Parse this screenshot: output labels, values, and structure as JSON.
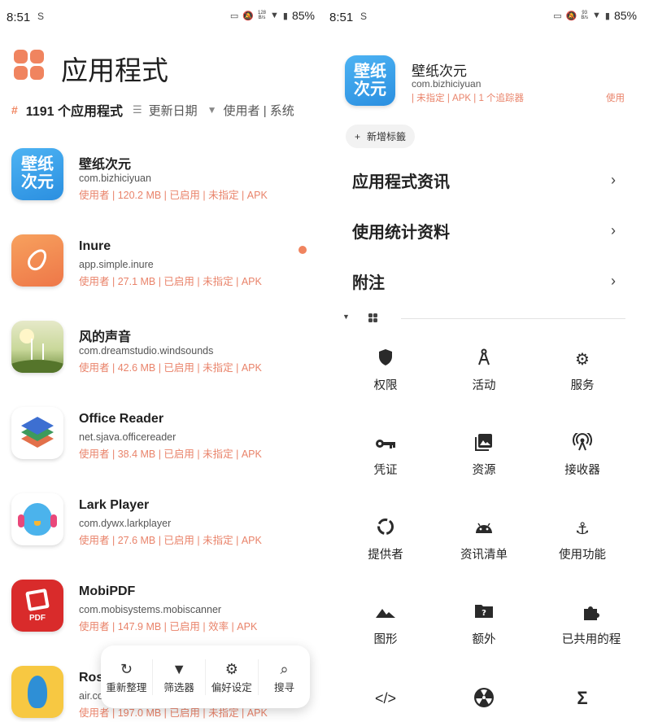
{
  "left_panel": {
    "status": {
      "time": "8:51",
      "sim_icon": "S",
      "net_speed_top": "128",
      "net_speed_unit": "B/s",
      "battery": "85%"
    },
    "title": "应用程式",
    "summary": {
      "count_label": "1191 个应用程式",
      "sort_label": "更新日期",
      "filter_label": "使用者 | 系统"
    },
    "apps": [
      {
        "name": "壁纸次元",
        "package": "com.bizhiciyuan",
        "meta": "使用者 | 120.2 MB | 已启用 | 未指定 | APK",
        "icon_text": "壁纸\n次元",
        "icon": "bizhiciyuan-icon"
      },
      {
        "name": "Inure",
        "package": "app.simple.inure",
        "meta": "使用者 | 27.1 MB | 已启用 | 未指定 | APK",
        "icon": "inure-icon",
        "badge": true
      },
      {
        "name": "风的声音",
        "package": "com.dreamstudio.windsounds",
        "meta": "使用者 | 42.6 MB | 已启用 | 未指定 | APK",
        "icon": "windmill-icon"
      },
      {
        "name": "Office Reader",
        "package": "net.sjava.officereader",
        "meta": "使用者 | 38.4 MB | 已启用 | 未指定 | APK",
        "icon": "office-reader-icon"
      },
      {
        "name": "Lark Player",
        "package": "com.dywx.larkplayer",
        "meta": "使用者 | 27.6 MB | 已启用 | 未指定 | APK",
        "icon": "lark-player-icon"
      },
      {
        "name": "MobiPDF",
        "package": "com.mobisystems.mobiscanner",
        "meta": "使用者 | 147.9 MB | 已启用 | 效率 | APK",
        "icon_text": "PDF",
        "icon": "mobipdf-icon"
      },
      {
        "name": "Ros",
        "package": "air.co",
        "meta": "使用者 | 197.0 MB | 已启用 | 未指定 | APK",
        "icon": "rosetta-icon"
      }
    ],
    "bottom_bar": [
      {
        "label": "重新整理",
        "icon": "refresh-icon"
      },
      {
        "label": "筛选器",
        "icon": "filter-icon"
      },
      {
        "label": "偏好设定",
        "icon": "gear-icon"
      },
      {
        "label": "搜寻",
        "icon": "search-icon"
      }
    ]
  },
  "right_panel": {
    "status": {
      "time": "8:51",
      "sim_icon": "S",
      "net_speed_top": "93",
      "net_speed_unit": "B/s",
      "battery": "85%"
    },
    "app": {
      "name": "壁纸次元",
      "package": "com.bizhiciyuan",
      "meta": "| 未指定 | APK | 1 个追踪器",
      "meta_tail": "使用",
      "icon_text": "壁纸\n次元"
    },
    "add_tag_label": "新增标籤",
    "sections": [
      "应用程式资讯",
      "使用统计资料",
      "附注"
    ],
    "features": [
      {
        "label": "权限",
        "icon": "shield-icon"
      },
      {
        "label": "活动",
        "icon": "compass-icon"
      },
      {
        "label": "服务",
        "icon": "gears-icon"
      },
      {
        "label": "凭证",
        "icon": "key-icon"
      },
      {
        "label": "资源",
        "icon": "image-icon"
      },
      {
        "label": "接收器",
        "icon": "antenna-icon"
      },
      {
        "label": "提供者",
        "icon": "loading-ring-icon"
      },
      {
        "label": "资讯清单",
        "icon": "android-icon"
      },
      {
        "label": "使用功能",
        "icon": "anchor-icon"
      },
      {
        "label": "图形",
        "icon": "mountain-icon"
      },
      {
        "label": "额外",
        "icon": "folder-question-icon"
      },
      {
        "label": "已共用的程",
        "icon": "puzzle-icon"
      },
      {
        "label": "",
        "icon": "code-icon"
      },
      {
        "label": "",
        "icon": "radiation-icon"
      },
      {
        "label": "",
        "icon": "sigma-icon"
      }
    ],
    "colors": {
      "accent": "#f0845f",
      "meta": "#e9836a"
    }
  }
}
